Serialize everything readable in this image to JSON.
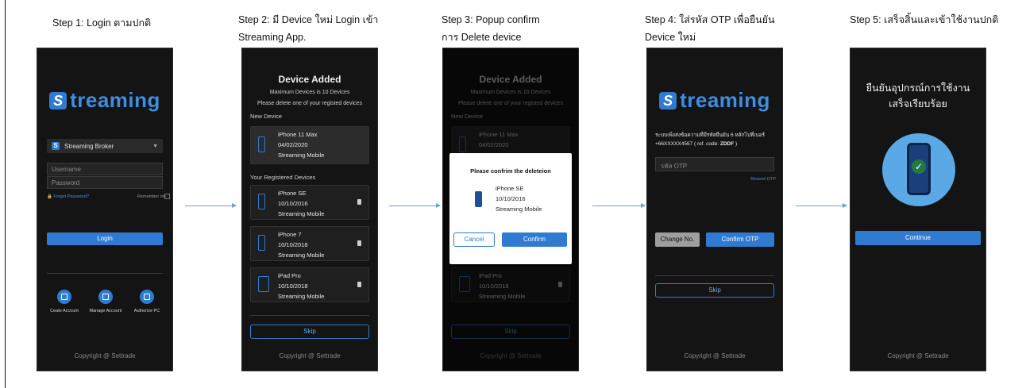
{
  "steps": [
    {
      "caption": "Step 1: Login ตามปกติ"
    },
    {
      "caption": "Step 2: มี Device ใหม่ Login เข้า Streaming App."
    },
    {
      "caption": "Step 3: Popup confirm การ Delete device"
    },
    {
      "caption": "Step 4: ใส่รหัส OTP เพื่อยืนยัน Device ใหม่"
    },
    {
      "caption": "Step 5: เสร็จสิ้นและเข้าใช้งานปกติ"
    }
  ],
  "copyright": "Copyright @ Settrade",
  "logo": {
    "mark": "S",
    "text": "treaming"
  },
  "login": {
    "broker": "Streaming Broker",
    "username_placeholder": "Username",
    "password_placeholder": "Password",
    "forget_password": "🔒 Forget Password?",
    "remember_me": "Remember me",
    "login_button": "Login",
    "actions": [
      "Ceate Account",
      "Manage Account",
      "Authorize PC"
    ]
  },
  "device_added": {
    "title": "Device Added",
    "subtitle1": "Maximum Devices is 10 Devices",
    "subtitle2": "Please delete one of your registed devices",
    "new_device_label": "New Device",
    "new_device": {
      "name": "iPhone 11 Max",
      "date": "04/02/2020",
      "app": "Streaming Mobile"
    },
    "registered_label": "Your Registered Devices",
    "registered": [
      {
        "name": "iPhone SE",
        "date": "10/10/2016",
        "app": "Streaming Mobile"
      },
      {
        "name": "iPhone 7",
        "date": "10/10/2018",
        "app": "Streaming Mobile"
      },
      {
        "name": "iPad Pro",
        "date": "10/10/2018",
        "app": "Streaming Mobile"
      }
    ],
    "skip": "Skip"
  },
  "popup": {
    "title": "Please confrim the deleteion",
    "device": {
      "name": "iPhone SE",
      "date": "10/10/2016",
      "app": "Streaming Mobile"
    },
    "cancel": "Cancel",
    "confirm": "Confirm"
  },
  "otp": {
    "message_line1": "ระบบเพิ่งส่งข้อความที่มีรหัสยืนยัน 6 หลักไปที่เบอร์",
    "message_line2_prefix": "+66XXXXX4567 ( ref. code: ",
    "ref_code": "ZDDF",
    "message_line2_suffix": " )",
    "otp_placeholder": "รหัส OTP",
    "resend": "Resend OTP",
    "change_no": "Change No.",
    "confirm_otp": "Confirm OTP",
    "skip": "Skip"
  },
  "success": {
    "line1": "ยืนยันอุปกรณ์การใช้งาน",
    "line2": "เสร็จเรียบร้อย",
    "continue": "Continue"
  },
  "colors": {
    "accent": "#2f7bd1",
    "screen_bg": "#141414",
    "arrow": "#6aa3d8"
  }
}
